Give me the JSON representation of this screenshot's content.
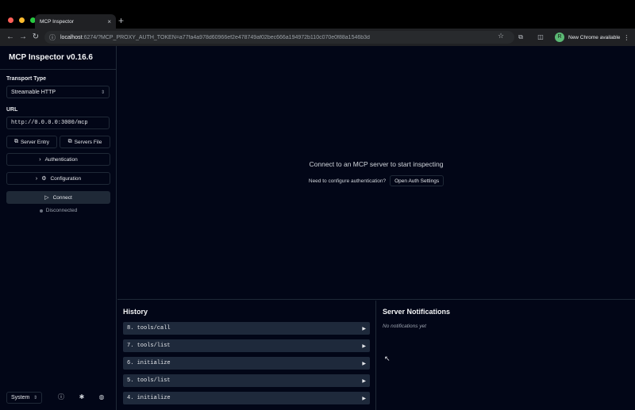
{
  "browser": {
    "tab_title": "MCP Inspector",
    "tab_close": "×",
    "new_tab": "+",
    "url_host": "localhost",
    "url_rest": ":6274/?MCP_PROXY_AUTH_TOKEN=a77fa4a978d60966ef2e478749af02bec666a194972b110c070e0f88a1546b3d",
    "update_label": "New Chrome available",
    "update_menu": "⋮",
    "profile_initial": "R",
    "icons": {
      "back": "arrow-left-icon",
      "forward": "arrow-right-icon",
      "reload": "reload-icon",
      "site_info": "site-info-icon",
      "bookmark": "star-icon",
      "extensions": "puzzle-icon",
      "split": "split-view-icon"
    }
  },
  "sidebar": {
    "title": "MCP Inspector v0.16.6",
    "transport_label": "Transport Type",
    "transport_value": "Streamable HTTP",
    "url_label": "URL",
    "url_value": "http://0.0.0.0:3000/mcp",
    "server_entry_label": "Server Entry",
    "servers_file_label": "Servers File",
    "authentication_label": "Authentication",
    "configuration_label": "Configuration",
    "connect_label": "Connect",
    "status_text": "Disconnected",
    "theme_value": "System",
    "footer_icons": [
      "help-icon",
      "bug-icon",
      "github-icon"
    ]
  },
  "main": {
    "empty_title": "Connect to an MCP server to start inspecting",
    "auth_hint": "Need to configure authentication?",
    "auth_button": "Open Auth Settings"
  },
  "history": {
    "title": "History",
    "items": [
      {
        "label": "8. tools/call"
      },
      {
        "label": "7. tools/list"
      },
      {
        "label": "6. initialize"
      },
      {
        "label": "5. tools/list"
      },
      {
        "label": "4. initialize"
      }
    ]
  },
  "notifications": {
    "title": "Server Notifications",
    "empty": "No notifications yet"
  },
  "colors": {
    "background": "#020617",
    "border": "#1f2937",
    "row": "#1e293b"
  }
}
